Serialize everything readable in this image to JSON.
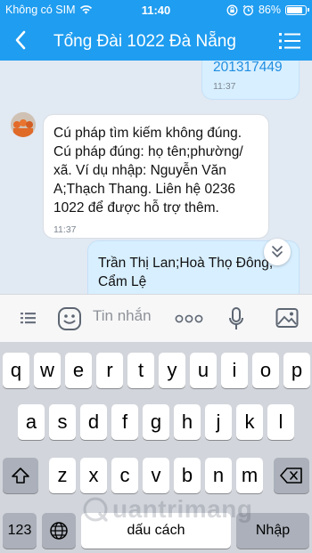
{
  "status_bar": {
    "carrier": "Không có SIM",
    "time": "11:40",
    "battery": "86%",
    "wifi_icon": "wifi-icon",
    "lock_icon": "rotation-lock-icon",
    "alarm_icon": "alarm-icon",
    "battery_icon": "battery-icon"
  },
  "nav": {
    "title": "Tổng Đài 1022 Đà Nẵng",
    "back_icon": "back-chevron-icon",
    "menu_icon": "menu-list-icon"
  },
  "messages": [
    {
      "side": "outgoing",
      "text": "201317449",
      "time": "11:37"
    },
    {
      "side": "incoming",
      "lines": [
        "Cú pháp tìm kiếm không đúng.",
        "Cú pháp đúng: họ tên;phường/",
        "xã. Ví dụ nhập: Nguyễn Văn",
        "A;Thạch Thang. Liên hệ 0236",
        "1022 để được hỗ trợ thêm."
      ],
      "time": "11:37"
    },
    {
      "side": "outgoing",
      "lines": [
        "Trần Thị Lan;Hoà Thọ Đông;",
        "Cẩm Lệ"
      ]
    }
  ],
  "input_bar": {
    "placeholder": "Tin nhắn",
    "list_icon": "list-icon",
    "emoji_icon": "sticker-icon",
    "more_icon": "more-dots-icon",
    "mic_icon": "microphone-icon",
    "image_icon": "image-icon"
  },
  "keyboard": {
    "row1": [
      "q",
      "w",
      "e",
      "r",
      "t",
      "y",
      "u",
      "i",
      "o",
      "p"
    ],
    "row2": [
      "a",
      "s",
      "d",
      "f",
      "g",
      "h",
      "j",
      "k",
      "l"
    ],
    "row3": [
      "z",
      "x",
      "c",
      "v",
      "b",
      "n",
      "m"
    ],
    "numbers_key": "123",
    "space_key": "dấu cách",
    "return_key": "Nhập",
    "shift_icon": "shift-icon",
    "backspace_icon": "backspace-icon",
    "globe_icon": "globe-icon"
  },
  "watermark": {
    "text": "uantrimang"
  }
}
